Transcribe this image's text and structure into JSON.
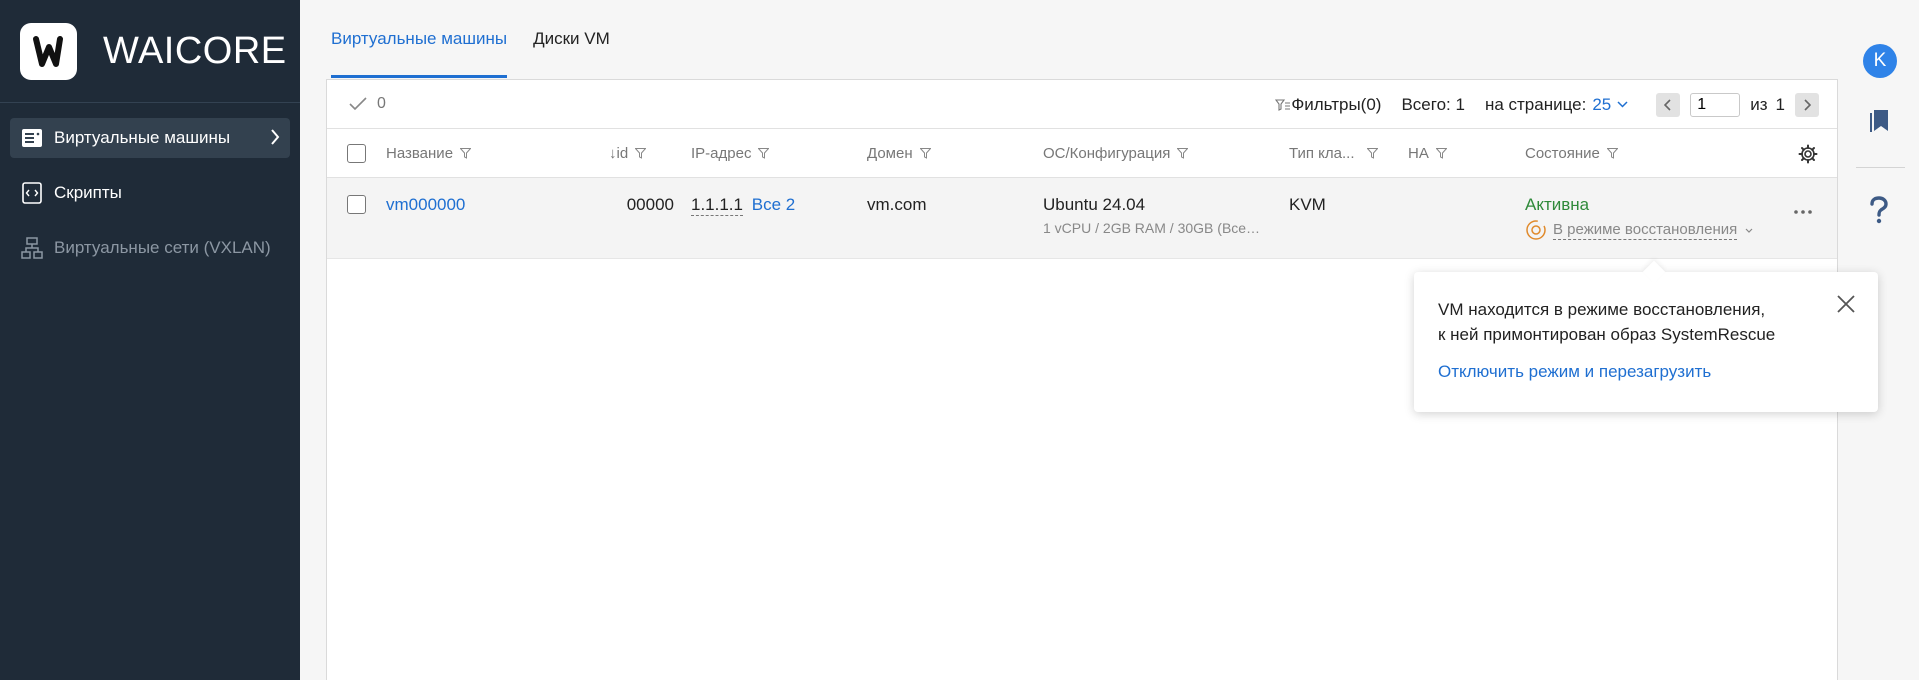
{
  "brand": {
    "name": "WAICORE"
  },
  "sidebar": {
    "items": [
      {
        "label": "Виртуальные машины"
      },
      {
        "label": "Скрипты"
      },
      {
        "label": "Виртуальные сети (VXLAN)"
      }
    ]
  },
  "tabs": [
    {
      "label": "Виртуальные машины"
    },
    {
      "label": "Диски VM"
    }
  ],
  "toolbar": {
    "selected_count": "0",
    "filters_label": "Фильтры(0)",
    "total_label": "Всего: 1",
    "per_page_label": "на странице:",
    "per_page_value": "25",
    "page_value": "1",
    "page_of_label": "из",
    "page_total": "1"
  },
  "table": {
    "headers": {
      "name": "Название",
      "id": "↓id",
      "ip": "IP-адрес",
      "domain": "Домен",
      "os": "ОС/Конфигурация",
      "type": "Тип кла...",
      "ha": "HA",
      "state": "Состояние"
    },
    "rows": [
      {
        "name": "vm000000",
        "id": "00000",
        "ip": "1.1.1.1",
        "ip_all": "Все 2",
        "domain": "vm.com",
        "os": "Ubuntu 24.04",
        "config": "1 vCPU / 2GB RAM / 30GB (Все…",
        "type": "KVM",
        "ha": "",
        "state": "Активна",
        "recovery": "В режиме восстановления"
      }
    ]
  },
  "popover": {
    "line1": "VM находится в режиме восстановления,",
    "line2": "к ней примонтирован образ SystemRescue",
    "action": "Отключить режим и перезагрузить"
  },
  "user": {
    "initial": "K"
  },
  "colors": {
    "accent": "#1f6fd1",
    "sidebar": "#1f2b38",
    "active_status": "#2f8a3a",
    "recovery_icon": "#e08a2c"
  }
}
